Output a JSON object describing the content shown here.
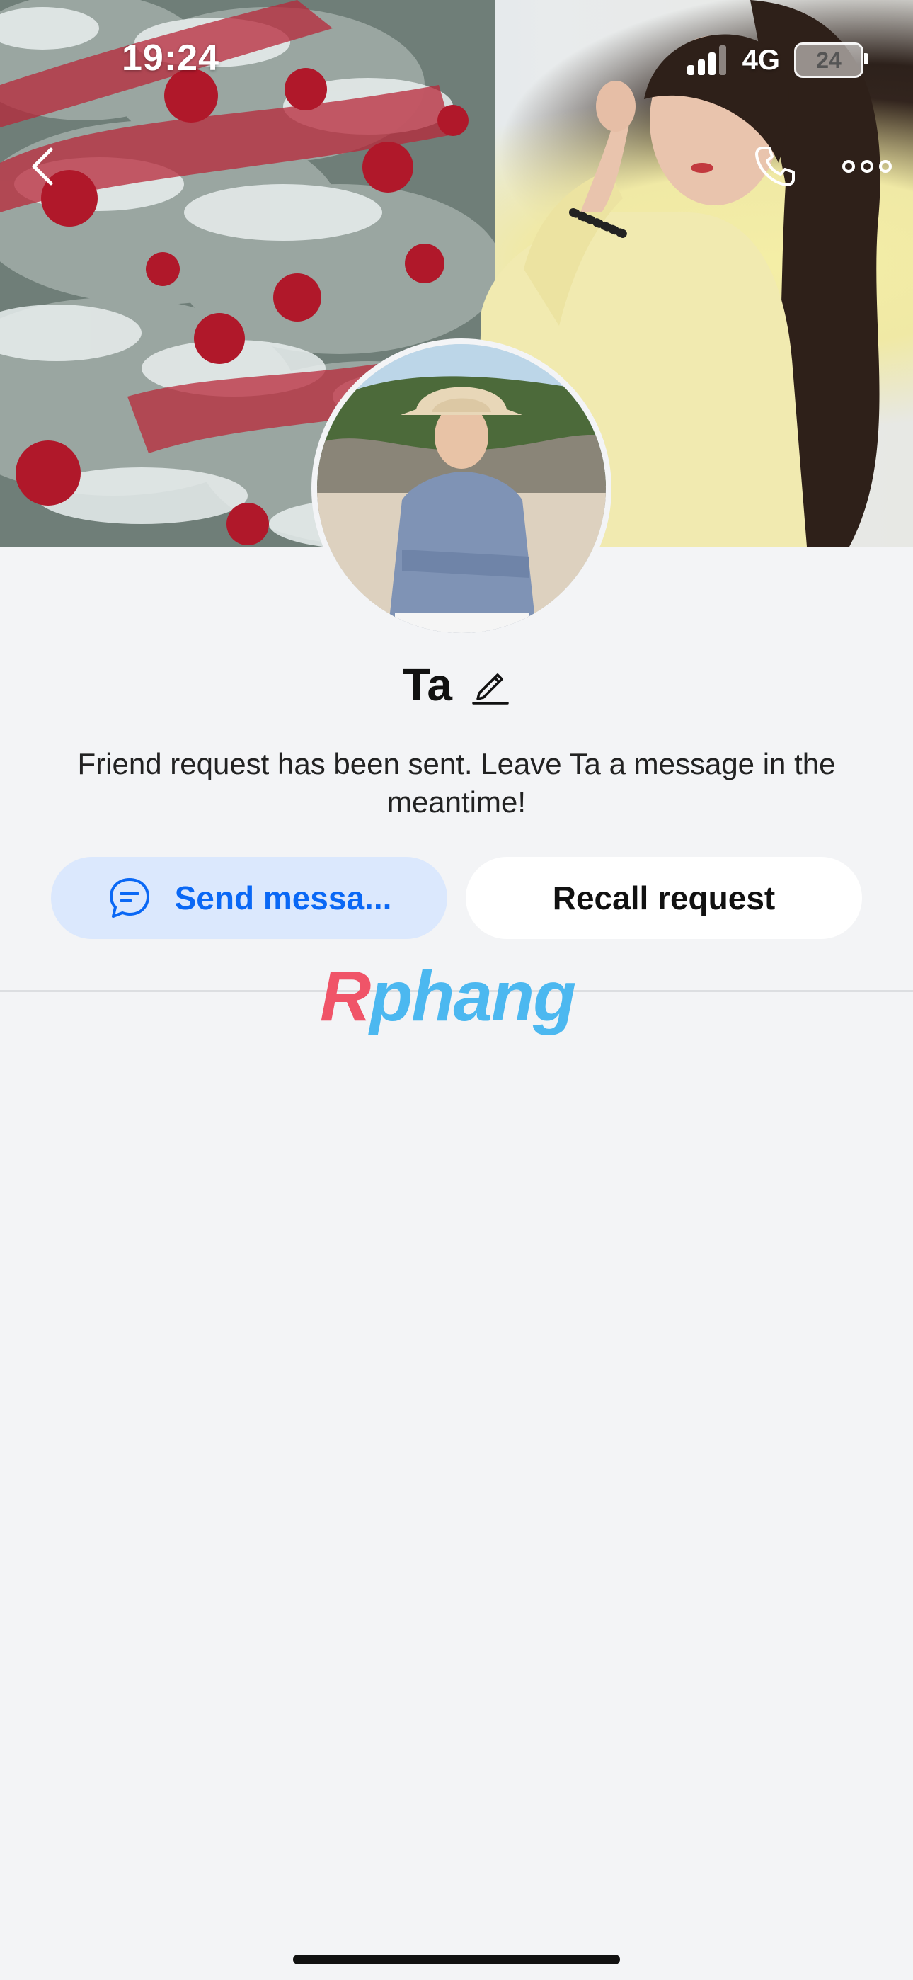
{
  "status_bar": {
    "time": "19:24",
    "network": "4G",
    "battery": "24"
  },
  "profile": {
    "name": "Ta",
    "notice": "Friend request has been sent. Leave Ta a message in the meantime!"
  },
  "actions": {
    "send_message_label": "Send messa...",
    "recall_request_label": "Recall request"
  },
  "watermark": {
    "first": "R",
    "rest": "phang"
  },
  "icons": {
    "back": "chevron-left-icon",
    "call": "phone-icon",
    "more": "more-horizontal-icon",
    "edit": "pencil-icon",
    "message": "chat-bubble-icon"
  },
  "colors": {
    "accent": "#0a68f5",
    "accent_bg": "#dbe8fd",
    "page_bg": "#f3f4f6"
  }
}
